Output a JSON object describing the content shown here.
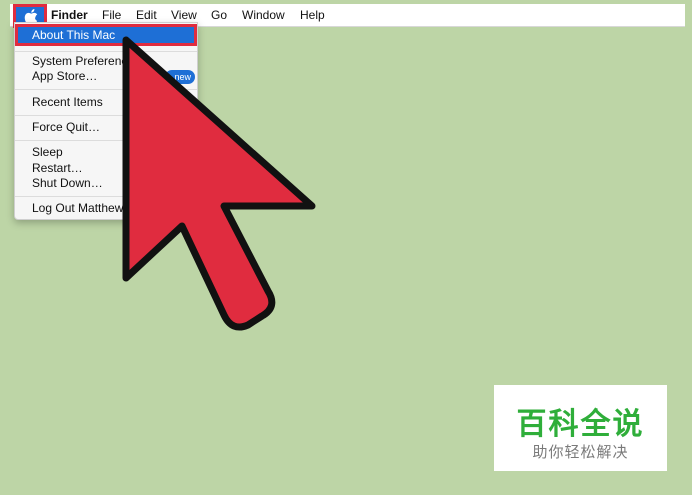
{
  "menubar": {
    "apple_icon": "apple-icon",
    "items": [
      "Finder",
      "File",
      "Edit",
      "View",
      "Go",
      "Window",
      "Help"
    ]
  },
  "apple_menu": {
    "about": "About This Mac",
    "system_prefs": "System Preferences…",
    "app_store": "App Store…",
    "app_store_badge": "new",
    "recent_items": "Recent Items",
    "force_quit": "Force Quit…",
    "sleep": "Sleep",
    "restart": "Restart…",
    "shut_down": "Shut Down…",
    "log_out": "Log Out Matthew…"
  },
  "watermark": {
    "title": "百科全说",
    "subtitle": "助你轻松解决"
  },
  "colors": {
    "desktop": "#bdd5a6",
    "highlight": "#1e6fd6",
    "annotation_red": "#e02c3f",
    "watermark_green": "#2fae3a"
  }
}
